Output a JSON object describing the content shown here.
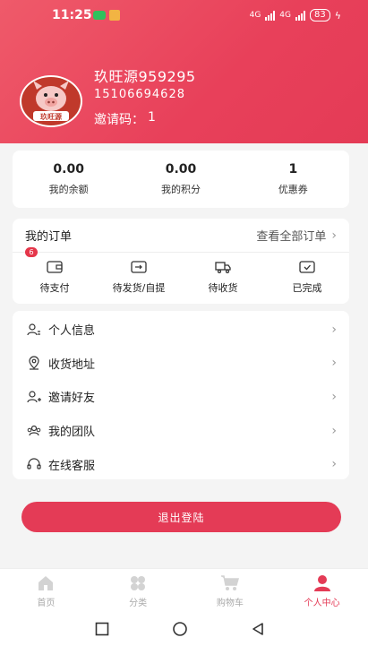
{
  "status": {
    "time": "11:25",
    "net1": "4G",
    "net2": "4G",
    "battery": "83"
  },
  "profile": {
    "avatar_text": "玖旺源",
    "name": "玖旺源959295",
    "phone": "15106694628",
    "invite_label": "邀请码：",
    "invite_code": "1"
  },
  "stats": [
    {
      "value": "0.00",
      "label": "我的余额"
    },
    {
      "value": "0.00",
      "label": "我的积分"
    },
    {
      "value": "1",
      "label": "优惠券"
    }
  ],
  "orders": {
    "title": "我的订单",
    "view_all": "查看全部订单",
    "items": [
      {
        "label": "待支付",
        "badge": "6",
        "icon": "wallet-icon"
      },
      {
        "label": "待发货/自提",
        "icon": "box-icon"
      },
      {
        "label": "待收货",
        "icon": "truck-icon"
      },
      {
        "label": "已完成",
        "icon": "check-box-icon"
      }
    ]
  },
  "menu": [
    {
      "label": "个人信息",
      "icon": "person-info-icon"
    },
    {
      "label": "收货地址",
      "icon": "location-icon"
    },
    {
      "label": "邀请好友",
      "icon": "add-user-icon"
    },
    {
      "label": "我的团队",
      "icon": "team-icon"
    },
    {
      "label": "在线客服",
      "icon": "headset-icon"
    }
  ],
  "logout_label": "退出登陆",
  "tabs": [
    {
      "label": "首页",
      "icon": "home-icon"
    },
    {
      "label": "分类",
      "icon": "category-icon"
    },
    {
      "label": "购物车",
      "icon": "cart-icon"
    },
    {
      "label": "个人中心",
      "icon": "user-icon",
      "active": true
    }
  ],
  "colors": {
    "accent": "#e43b56",
    "badge": "#e5364a"
  }
}
